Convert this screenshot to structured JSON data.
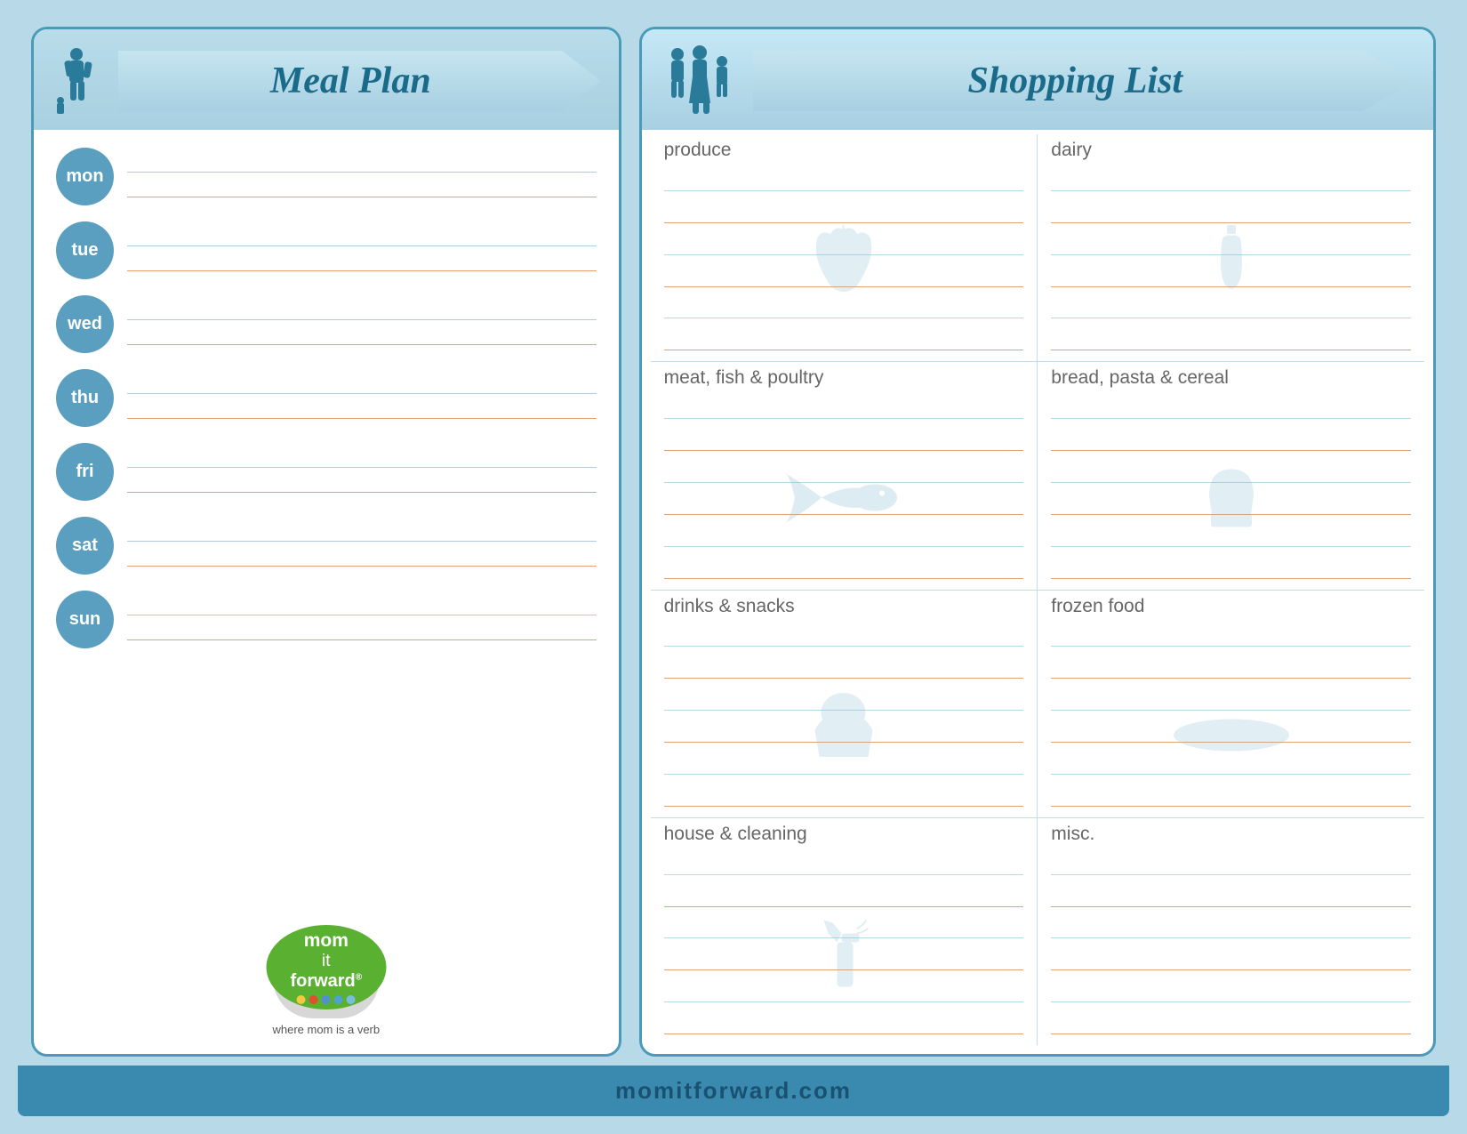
{
  "mealPlan": {
    "title": "Meal Plan",
    "days": [
      {
        "label": "mon"
      },
      {
        "label": "tue"
      },
      {
        "label": "wed"
      },
      {
        "label": "thu"
      },
      {
        "label": "fri"
      },
      {
        "label": "sat"
      },
      {
        "label": "sun"
      }
    ]
  },
  "shoppingList": {
    "title": "Shopping List",
    "sections": [
      {
        "id": "produce",
        "label": "produce"
      },
      {
        "id": "dairy",
        "label": "dairy"
      },
      {
        "id": "meat",
        "label": "meat, fish & poultry"
      },
      {
        "id": "bread",
        "label": "bread, pasta & cereal"
      },
      {
        "id": "drinks",
        "label": "drinks & snacks"
      },
      {
        "id": "frozen",
        "label": "frozen food"
      },
      {
        "id": "house",
        "label": "house & cleaning"
      },
      {
        "id": "misc",
        "label": "misc."
      }
    ]
  },
  "logo": {
    "line1": "mom",
    "line2": "it",
    "line3": "forward",
    "reg": "®",
    "tagline": "where mom is a verb"
  },
  "footer": {
    "text": "momitforward.com"
  }
}
